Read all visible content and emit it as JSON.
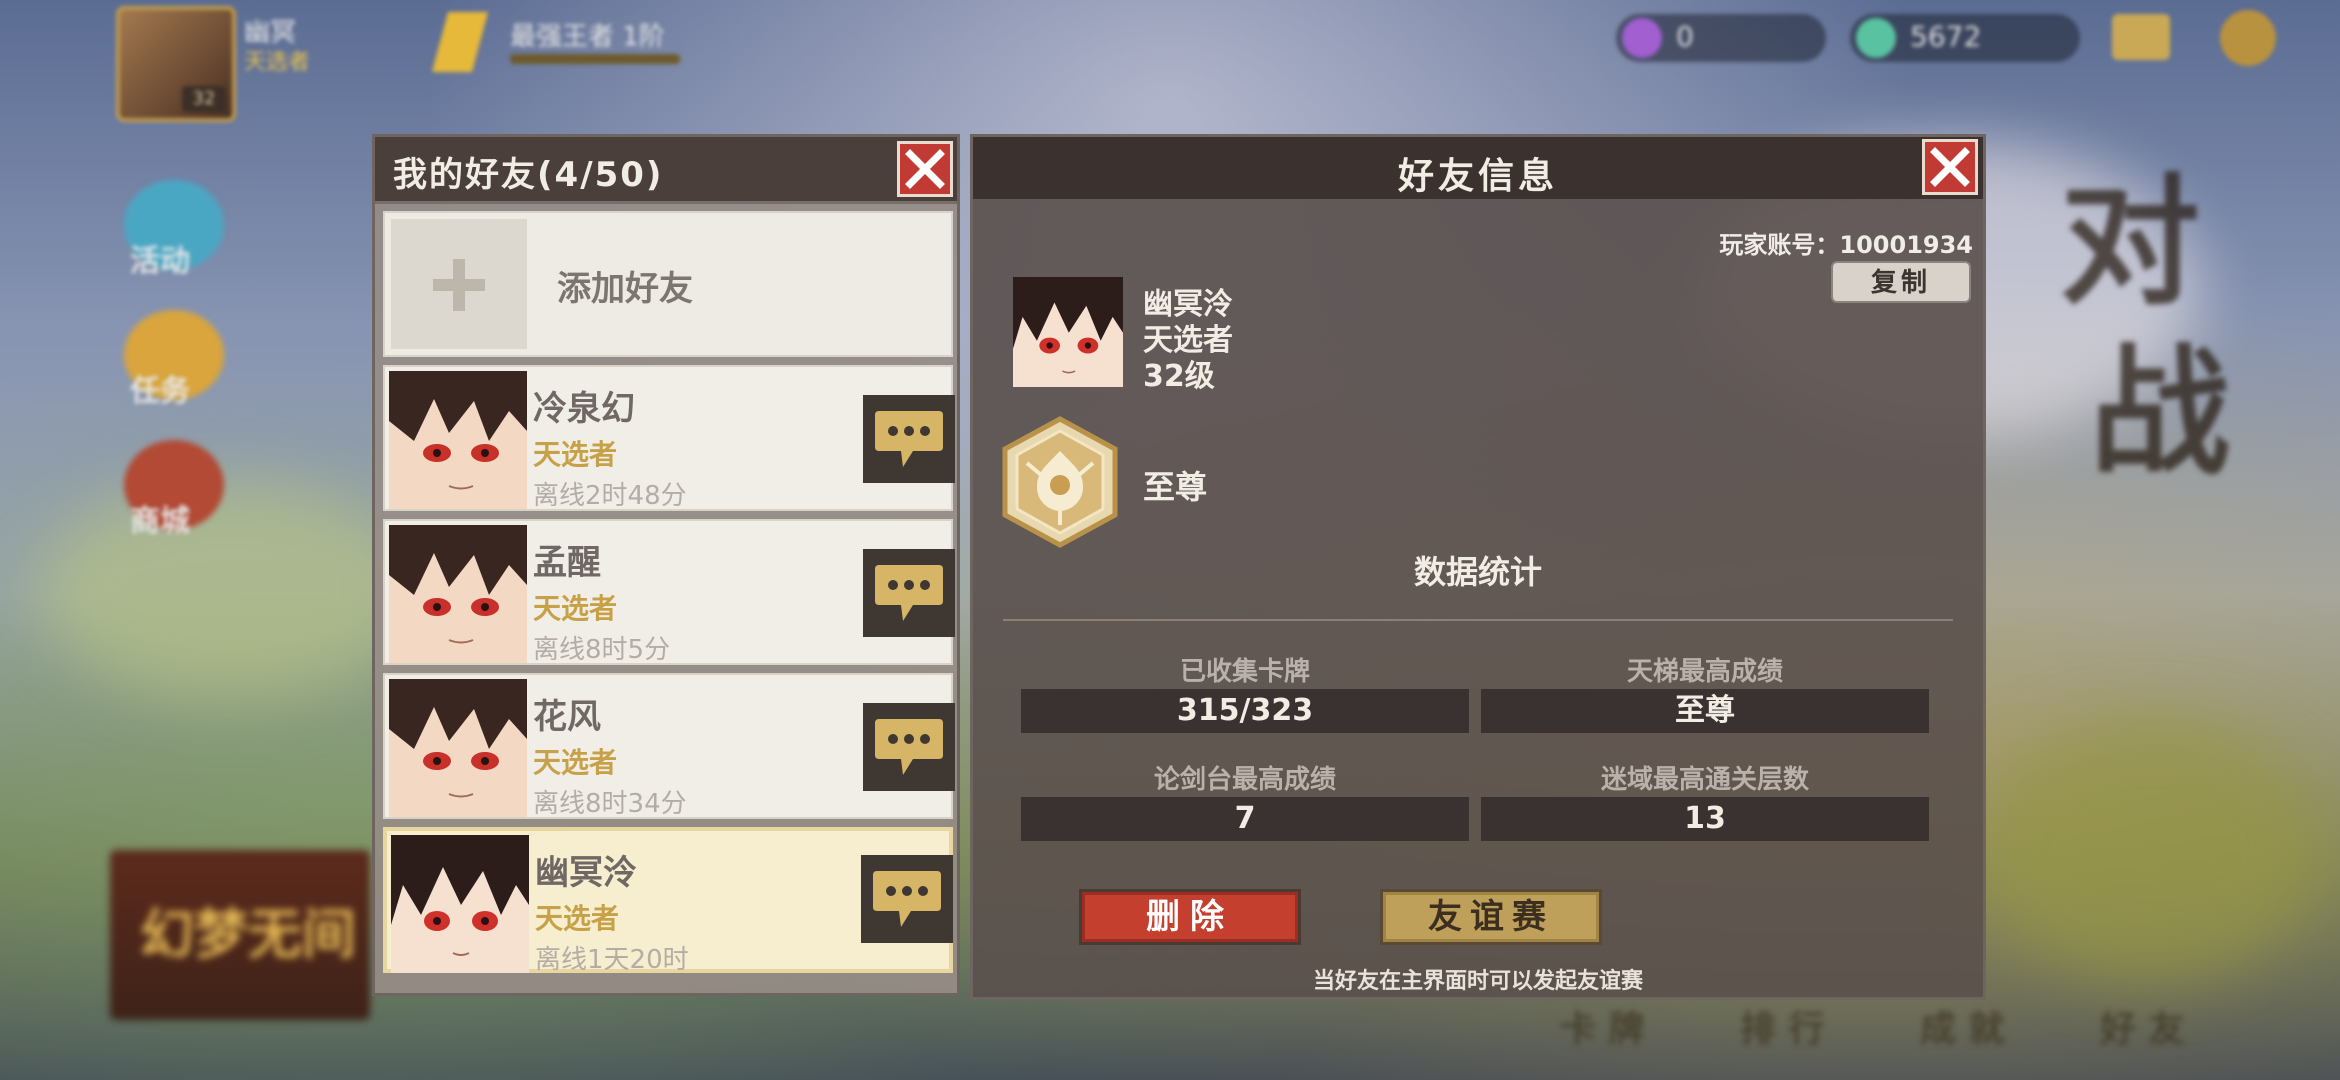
{
  "top_bar": {
    "player_name": "幽冥",
    "player_title": "天选者",
    "player_level": "32",
    "rank_text": "最强王者 1阶",
    "currency_1": "0",
    "currency_2": "5672"
  },
  "side_menu": [
    "活动",
    "任务",
    "商城"
  ],
  "bottom_menu": [
    "卡 牌",
    "排 行",
    "成 就",
    "好 友"
  ],
  "event_banner": "幻梦无间",
  "background_chars": [
    "对",
    "战"
  ],
  "friends_panel": {
    "title": "我的好友(4/50)",
    "add_friend_label": "添加好友",
    "friends": [
      {
        "name": "冷泉幻",
        "title": "天选者",
        "status": "离线2时48分"
      },
      {
        "name": "孟醒",
        "title": "天选者",
        "status": "离线8时5分"
      },
      {
        "name": "花风",
        "title": "天选者",
        "status": "离线8时34分"
      },
      {
        "name": "幽冥泠",
        "title": "天选者",
        "status": "离线1天20时"
      }
    ]
  },
  "info_panel": {
    "title": "好友信息",
    "account": "玩家账号：10001934",
    "copy_label": "复制",
    "name": "幽冥泠",
    "rank_title": "天选者",
    "level": "32级",
    "badge_label": "至尊",
    "stats_heading": "数据统计",
    "stats": [
      {
        "label": "已收集卡牌",
        "value": "315/323"
      },
      {
        "label": "天梯最高成绩",
        "value": "至尊"
      },
      {
        "label": "论剑台最高成绩",
        "value": "7"
      },
      {
        "label": "迷域最高通关层数",
        "value": "13"
      }
    ],
    "delete_label": "删除",
    "match_label": "友谊赛",
    "hint": "当好友在主界面时可以发起友谊赛"
  },
  "colors": {
    "close_red": "#c23a34",
    "title_gold": "#c7a147",
    "delete_red": "#c53f2e",
    "match_gold": "#bfa05a"
  },
  "icons": [
    "close-icon",
    "plus-icon",
    "chat-bubble-icon",
    "rank-badge-icon"
  ]
}
